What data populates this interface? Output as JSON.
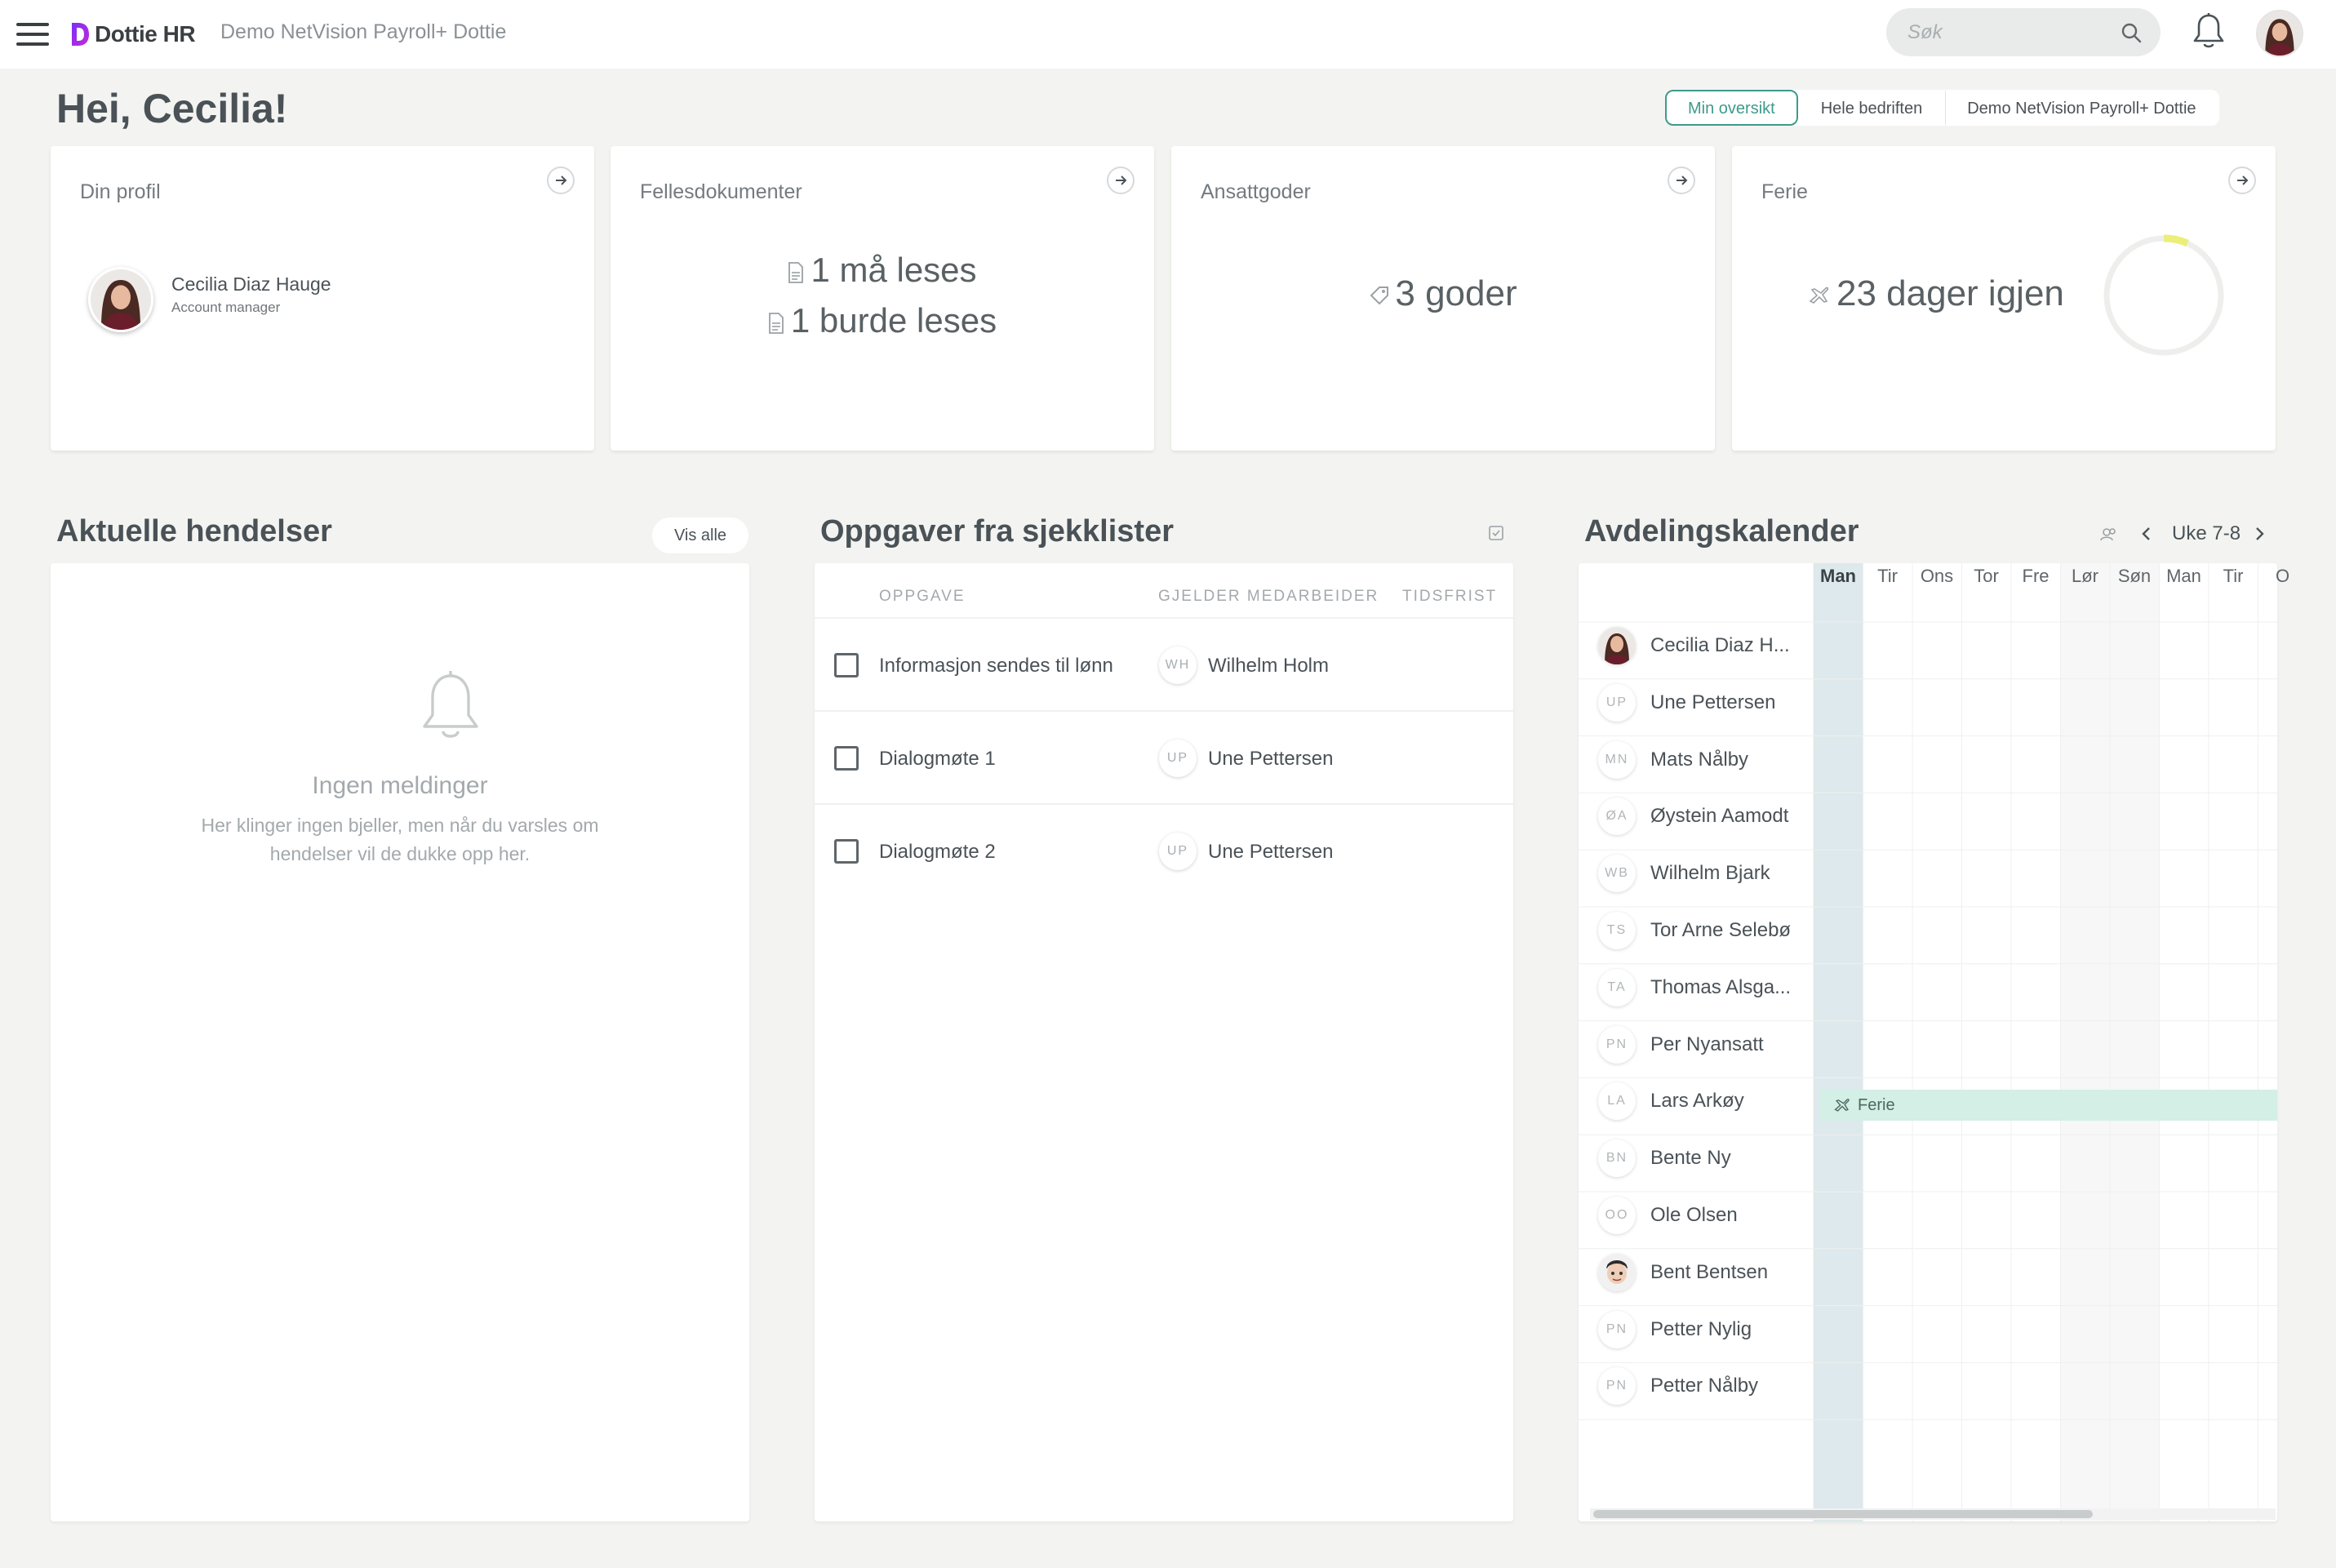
{
  "header": {
    "app_name": "Dottie HR",
    "company": "Demo NetVision Payroll+ Dottie",
    "search_placeholder": "Søk"
  },
  "greeting": "Hei, Cecilia!",
  "view_tabs": [
    "Min oversikt",
    "Hele bedriften",
    "Demo NetVision Payroll+ Dottie"
  ],
  "cards": {
    "profile": {
      "title": "Din profil",
      "name": "Cecilia Diaz Hauge",
      "role": "Account manager"
    },
    "documents": {
      "title": "Fellesdokumenter",
      "must_read": "1 må leses",
      "should_read": "1 burde leses"
    },
    "benefits": {
      "title": "Ansattgoder",
      "value": "3 goder"
    },
    "vacation": {
      "title": "Ferie",
      "value": "23 dager igjen"
    }
  },
  "events": {
    "title": "Aktuelle hendelser",
    "see_all": "Vis alle",
    "empty_title": "Ingen meldinger",
    "empty_text": "Her klinger ingen bjeller, men når du varsles om hendelser vil de dukke opp her."
  },
  "tasks": {
    "title": "Oppgaver fra sjekklister",
    "columns": [
      "OPPGAVE",
      "GJELDER MEDARBEIDER",
      "TIDSFRIST"
    ],
    "rows": [
      {
        "task": "Informasjon sendes til lønn",
        "initials": "WH",
        "employee": "Wilhelm Holm"
      },
      {
        "task": "Dialogmøte 1",
        "initials": "UP",
        "employee": "Une Pettersen"
      },
      {
        "task": "Dialogmøte 2",
        "initials": "UP",
        "employee": "Une Pettersen"
      }
    ]
  },
  "calendar": {
    "title": "Avdelingskalender",
    "week_label": "Uke 7-8",
    "days": [
      "Man",
      "Tir",
      "Ons",
      "Tor",
      "Fre",
      "Lør",
      "Søn",
      "Man",
      "Tir",
      "O"
    ],
    "people": [
      {
        "initials": "",
        "name": "Cecilia Diaz H..."
      },
      {
        "initials": "UP",
        "name": "Une Pettersen"
      },
      {
        "initials": "MN",
        "name": "Mats Nålby"
      },
      {
        "initials": "ØA",
        "name": "Øystein Aamodt"
      },
      {
        "initials": "WB",
        "name": "Wilhelm Bjark"
      },
      {
        "initials": "TS",
        "name": "Tor Arne Selebø"
      },
      {
        "initials": "TA",
        "name": "Thomas Alsga..."
      },
      {
        "initials": "PN",
        "name": "Per Nyansatt"
      },
      {
        "initials": "LA",
        "name": "Lars Arkøy"
      },
      {
        "initials": "BN",
        "name": "Bente Ny"
      },
      {
        "initials": "OO",
        "name": "Ole Olsen"
      },
      {
        "initials": "",
        "name": "Bent Bentsen"
      },
      {
        "initials": "PN",
        "name": "Petter Nylig"
      },
      {
        "initials": "PN",
        "name": "Petter Nålby"
      }
    ],
    "event_label": "Ferie"
  },
  "colors": {
    "accent": "#3e9a8c",
    "today_column": "#dde9ec",
    "ferie_bar": "#d4efe5",
    "vacation_ring": "#ecee7a"
  }
}
